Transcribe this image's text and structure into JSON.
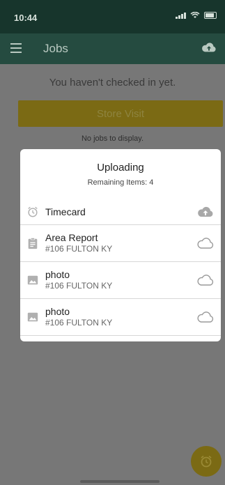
{
  "status_bar": {
    "time": "10:44"
  },
  "app_bar": {
    "title": "Jobs",
    "menu_icon": "hamburger-icon",
    "upload_icon": "cloud-upload-icon"
  },
  "main": {
    "checkin_message": "You haven't checked in yet.",
    "store_visit_label": "Store Visit",
    "empty_message": "No jobs to display.",
    "fab_icon": "alarm-clock-icon"
  },
  "modal": {
    "title": "Uploading",
    "subtitle": "Remaining Items: 4",
    "items": [
      {
        "name": "Timecard",
        "location": "",
        "icon": "alarm-clock-icon",
        "status_icon": "cloud-upload-filled-icon"
      },
      {
        "name": "Area Report",
        "location": "#106 FULTON KY",
        "icon": "clipboard-icon",
        "status_icon": "cloud-outline-icon"
      },
      {
        "name": "photo",
        "location": "#106 FULTON KY",
        "icon": "image-icon",
        "status_icon": "cloud-outline-icon"
      },
      {
        "name": "photo",
        "location": "#106 FULTON KY",
        "icon": "image-icon",
        "status_icon": "cloud-outline-icon"
      }
    ]
  },
  "colors": {
    "app_bar": "#254b40",
    "accent_yellow": "#7b6a14",
    "overlay_gray": "#777777",
    "modal_bg": "#ffffff"
  }
}
